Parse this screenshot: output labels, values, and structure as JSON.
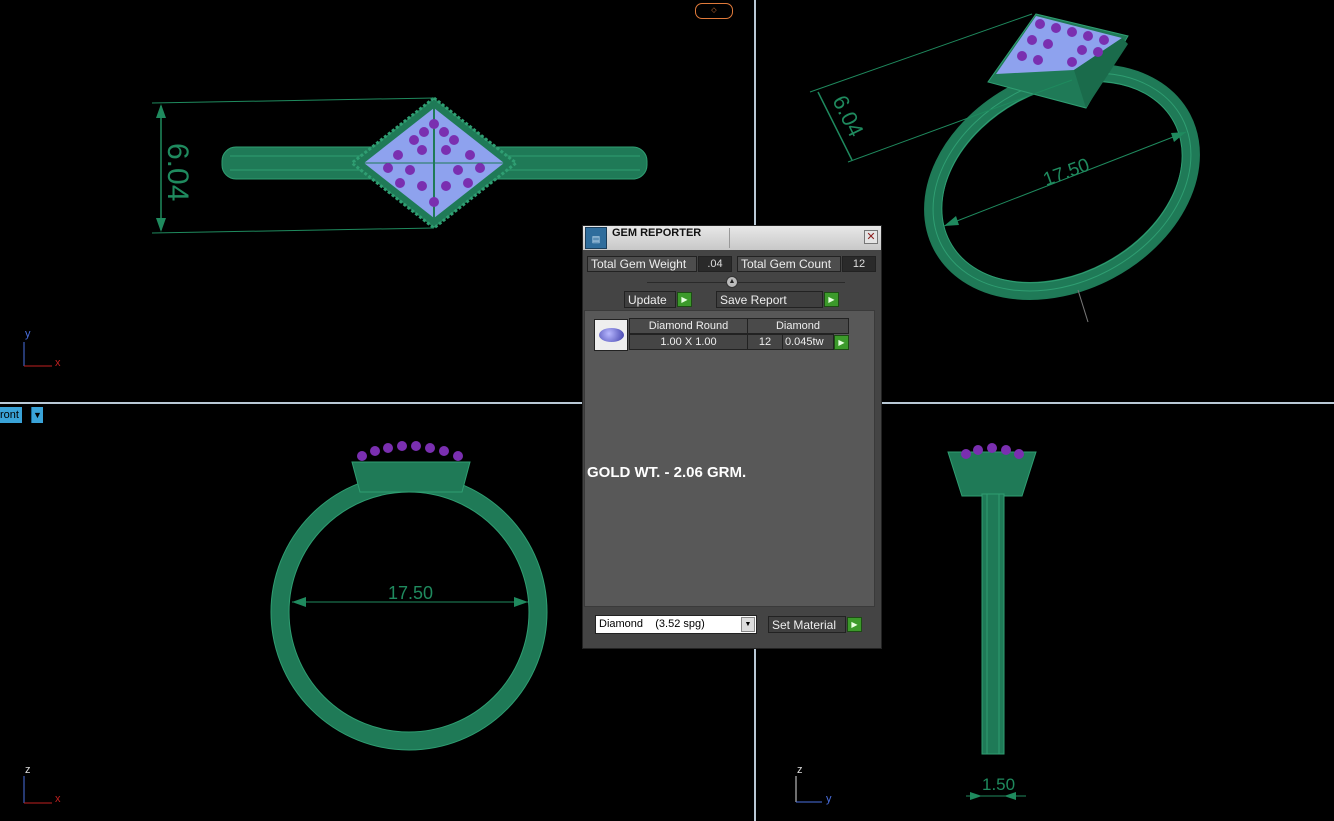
{
  "viewport": {
    "top_left": {
      "dimension": "6.04",
      "axis_v": "y",
      "axis_h": "x"
    },
    "top_right": {
      "dimension_width": "6.04",
      "dimension_length": "17.50"
    },
    "bottom_left": {
      "dimension": "17.50",
      "axis_v": "z",
      "axis_h": "x",
      "view_name": "ront"
    },
    "bottom_right": {
      "dimension": "1.50",
      "axis_v": "z",
      "axis_h": "y"
    }
  },
  "colors": {
    "ring": "#1f7a57",
    "ring_light": "#2f9e72",
    "dim_line": "#1f8a5e",
    "gem_blue": "#8ea2ee",
    "gem_purple": "#7a2fb0"
  },
  "gem_reporter": {
    "title": "GEM REPORTER",
    "icon": "report-icon",
    "total_gem_weight_label": "Total Gem Weight",
    "total_gem_weight_value": ".04",
    "total_gem_count_label": "Total Gem Count",
    "total_gem_count_value": "12",
    "update_label": "Update",
    "save_report_label": "Save Report",
    "gem_row": {
      "name": "Diamond Round",
      "material": "Diamond",
      "size": "1.00 X 1.00",
      "count": "12",
      "weight": "0.045tw"
    },
    "gold_weight_note": "GOLD WT. - 2.06 GRM.",
    "material_select_value": "Diamond    (3.52 spg)",
    "set_material_label": "Set Material"
  }
}
